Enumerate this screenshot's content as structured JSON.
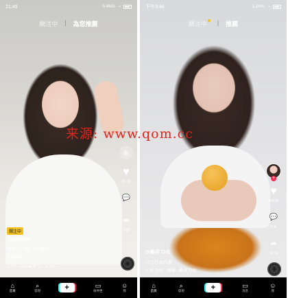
{
  "left_phone": {
    "status": {
      "time": "21:49",
      "network": "5.4M/s"
    },
    "tabs": {
      "following": "關注中",
      "for_you": "為您推薦"
    },
    "actions": {
      "likes": "20.7K",
      "comments": "",
      "shares": "分享"
    },
    "caption": {
      "badge": "關注中",
      "username": "@y062546",
      "description": "母です（笑）#下書き",
      "translate": "查看翻譯",
      "music": "♫ YN - ocra♥(セラ)　KYN -"
    },
    "nav": {
      "home": "首頁",
      "discover": "發現",
      "inbox": "收件匣",
      "profile": "我"
    }
  },
  "right_phone": {
    "status": {
      "time": "下午3:46",
      "network": "1.2M/s"
    },
    "tabs": {
      "following": "關注中",
      "for_you": "推薦"
    },
    "actions": {
      "likes": "436.8k",
      "comments": "9.9k",
      "shares": "12.3k"
    },
    "caption": {
      "username": "@桑井 ひな",
      "description": "バカ日本代表",
      "music": "♫ 井 ひな　原聲 - 桑井 ひな"
    },
    "nav": {
      "home": "首頁",
      "discover": "發現",
      "inbox": "消息",
      "profile": "我"
    }
  },
  "watermark": "来源:  www.qom.cc",
  "colors": {
    "accent_yellow": "#f3c21f",
    "tiktok_red": "#fe2c55",
    "tiktok_cyan": "#25f4ee",
    "watermark_red": "#e0241b"
  }
}
